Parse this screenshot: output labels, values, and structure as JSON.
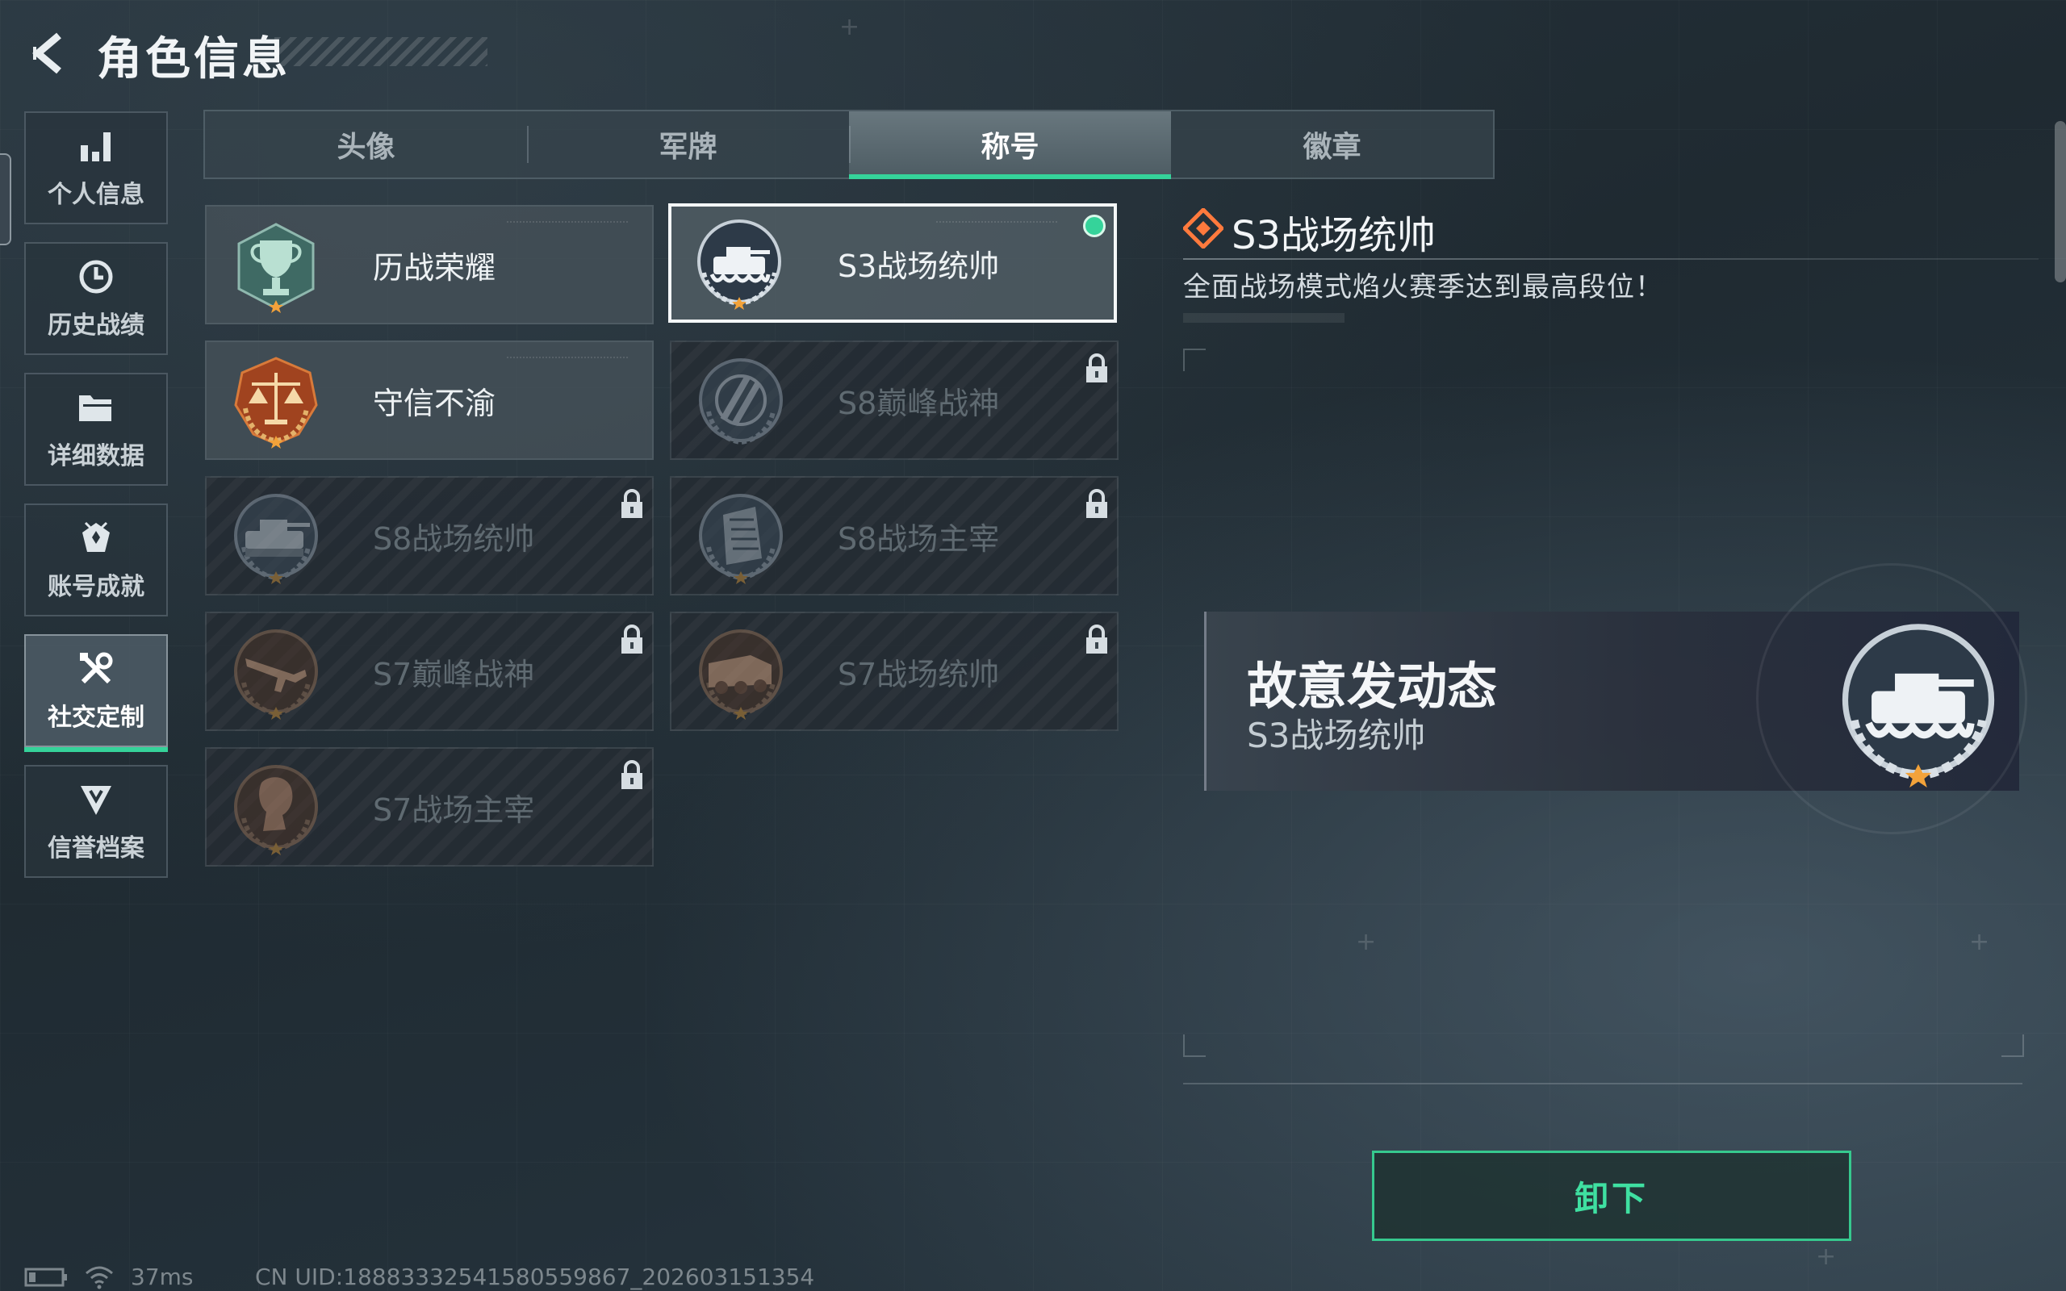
{
  "header": {
    "title": "角色信息"
  },
  "sidebar": {
    "items": [
      {
        "label": "个人信息",
        "icon": "bar-chart-icon"
      },
      {
        "label": "历史战绩",
        "icon": "clock-icon"
      },
      {
        "label": "详细数据",
        "icon": "folder-icon"
      },
      {
        "label": "账号成就",
        "icon": "achievement-icon"
      },
      {
        "label": "社交定制",
        "icon": "tools-icon",
        "active": true
      },
      {
        "label": "信誉档案",
        "icon": "shield-icon"
      }
    ]
  },
  "tabs": [
    {
      "label": "头像"
    },
    {
      "label": "军牌"
    },
    {
      "label": "称号",
      "active": true
    },
    {
      "label": "徽章"
    }
  ],
  "titles": [
    {
      "name": "历战荣耀",
      "locked": false,
      "medal": "trophy-medal-icon"
    },
    {
      "name": "S3战场统帅",
      "locked": false,
      "selected": true,
      "equipped": true,
      "medal": "tank-medal-icon"
    },
    {
      "name": "守信不渝",
      "locked": false,
      "medal": "scales-medal-icon"
    },
    {
      "name": "S8巅峰战神",
      "locked": true,
      "medal": "emblem-medal-icon"
    },
    {
      "name": "S8战场统帅",
      "locked": true,
      "medal": "tank-medal-icon"
    },
    {
      "name": "S8战场主宰",
      "locked": true,
      "medal": "building-medal-icon"
    },
    {
      "name": "S7巅峰战神",
      "locked": true,
      "medal": "rifle-medal-icon"
    },
    {
      "name": "S7战场统帅",
      "locked": true,
      "medal": "vehicle-medal-icon"
    },
    {
      "name": "S7战场主宰",
      "locked": true,
      "medal": "soldier-medal-icon"
    }
  ],
  "detail": {
    "title": "S3战场统帅",
    "description": "全面战场模式焰火赛季达到最高段位！"
  },
  "preview": {
    "player_name": "故意发动态",
    "title": "S3战场统帅"
  },
  "actions": {
    "unequip_label": "卸下"
  },
  "status": {
    "ping": "37ms",
    "uid": "CN UID:18883332541580559867_202603151354"
  },
  "colors": {
    "accent": "#35d39a",
    "background": "#222e36",
    "locked_text": "#5f6a71"
  }
}
